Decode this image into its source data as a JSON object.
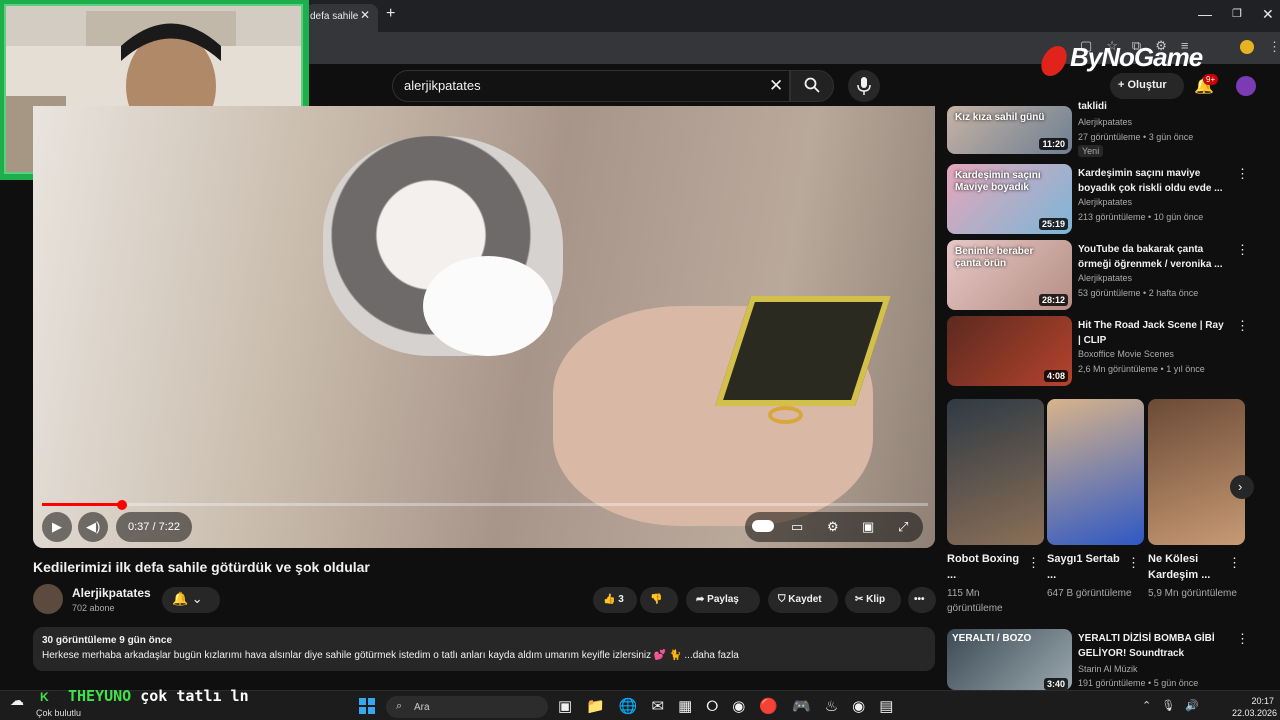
{
  "browser": {
    "tab_title": "defa sahile",
    "tab_close": "✕",
    "new_tab": "+",
    "window": {
      "minimize": "—",
      "maximize": "❐",
      "close": "✕"
    }
  },
  "header": {
    "search_value": "alerjikpatates",
    "clear_glyph": "✕",
    "create_label": "Oluştur",
    "create_glyph": "+",
    "notif_badge": "9+",
    "bell_glyph": "🔔"
  },
  "overlay": {
    "brand": "ByNoGame"
  },
  "player": {
    "time": "0:37 / 7:22",
    "progress_fraction": 0.09,
    "play_glyph": "▶",
    "volume_glyph": "◀)"
  },
  "video": {
    "title": "Kedilerimizi ilk defa sahile götürdük ve şok oldular",
    "channel": "Alerjikpatates",
    "subscribers": "702 abone",
    "likes": "3",
    "share": "Paylaş",
    "save": "Kaydet",
    "clip": "Klip",
    "more": "•••",
    "description_meta": "30 görüntüleme  9 gün önce",
    "description": "Herkese merhaba arkadaşlar bugün kızlarımı hava alsınlar diye sahile götürmek istedim o tatlı anları kayda aldım umarım keyifle izlersiniz 💕 🐈 ...daha fazla"
  },
  "recommendations": [
    {
      "title": "taklidi",
      "channel": "Alerjikpatates",
      "meta": "27 görüntüleme • 3 gün önce",
      "badge": "Yeni",
      "duration": "11:20",
      "thumb_text": "Kız kıza sahil günü",
      "color1": "#c7b3a4",
      "color2": "#6d7f93"
    },
    {
      "title": "Kardeşimin saçını maviye boyadık çok riskli oldu evde ...",
      "channel": "Alerjikpatates",
      "meta": "213 görüntüleme • 10 gün önce",
      "badge": "",
      "duration": "25:19",
      "thumb_text": "Kardeşimin saçını Maviye boyadık",
      "color1": "#e6a6b9",
      "color2": "#7bb6d8"
    },
    {
      "title": "YouTube da bakarak çanta örmeği öğrenmek / veronika ...",
      "channel": "Alerjikpatates",
      "meta": "53 görüntüleme • 2 hafta önce",
      "badge": "",
      "duration": "28:12",
      "thumb_text": "Benimle beraber çanta örün",
      "color1": "#e7c7c6",
      "color2": "#b58e84"
    },
    {
      "title": "Hit The Road Jack Scene | Ray | CLIP",
      "channel": "Boxoffice Movie Scenes",
      "meta": "2,6 Mn görüntüleme • 1 yıl önce",
      "badge": "",
      "duration": "4:08",
      "thumb_text": "",
      "color1": "#5b2a1f",
      "color2": "#b5432d"
    }
  ],
  "shorts": [
    {
      "title": "Robot Boxing ...",
      "views": "115 Mn görüntüleme",
      "color1": "#2f3a44",
      "color2": "#8b6f57"
    },
    {
      "title": "Saygı1 Sertab ...",
      "views": "647 B görüntüleme",
      "color1": "#d8b48a",
      "color2": "#2e58c4"
    },
    {
      "title": "Ne Kölesi Kardeşim ...",
      "views": "5,9 Mn görüntüleme",
      "color1": "#6b4a36",
      "color2": "#c79a74"
    }
  ],
  "bottom_rec": {
    "title": "YERALTI DİZİSİ BOMBA GİBİ GELİYOR! Soundtrack",
    "channel": "Starin Al Müzik",
    "meta": "191 görüntüleme • 5 gün önce",
    "duration": "3:40",
    "thumb_text": "YERALTI / BOZO",
    "color1": "#3c4a55",
    "color2": "#9aa7ae"
  },
  "taskbar": {
    "weather": "Çok bulutlu",
    "search_placeholder": "Ara",
    "overlay_k": "K",
    "overlay_name": "THEYUNO",
    "overlay_msg": "çok tatlı ln",
    "time": "20:17",
    "date": "22.03.2026"
  },
  "colors": {
    "accent": "#ff0000",
    "bg": "#0f0f0f",
    "chip": "#272727"
  }
}
